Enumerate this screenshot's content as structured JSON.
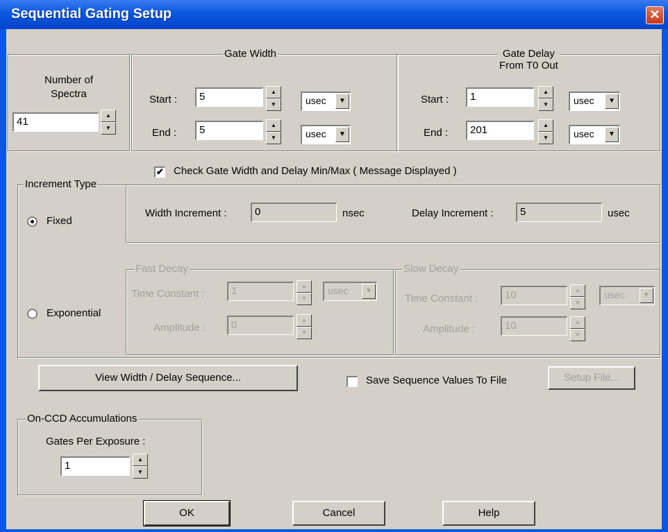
{
  "window": {
    "title": "Sequential Gating Setup",
    "close_glyph": "✕"
  },
  "spectra": {
    "label": "Number of\nSpectra",
    "value": "41"
  },
  "gate_width": {
    "title": "Gate Width",
    "start_label": "Start :",
    "start_value": "5",
    "start_unit": "usec",
    "end_label": "End :",
    "end_value": "5",
    "end_unit": "usec"
  },
  "gate_delay": {
    "title": "Gate Delay\nFrom T0 Out",
    "start_label": "Start :",
    "start_value": "1",
    "start_unit": "usec",
    "end_label": "End :",
    "end_value": "201",
    "end_unit": "usec"
  },
  "check_minmax": {
    "label": "Check Gate  Width and Delay Min/Max ( Message Displayed )",
    "checked": true
  },
  "increment": {
    "title": "Increment Type",
    "fixed_label": "Fixed",
    "exponential_label": "Exponential",
    "selected": "fixed",
    "width_label": "Width Increment :",
    "width_value": "0",
    "width_unit": "nsec",
    "delay_label": "Delay Increment :",
    "delay_value": "5",
    "delay_unit": "usec"
  },
  "fast_decay": {
    "title": "Fast Decay",
    "time_label": "Time Constant :",
    "time_value": "1",
    "time_unit": "usec",
    "amp_label": "Amplitude :",
    "amp_value": "0"
  },
  "slow_decay": {
    "title": "Slow Decay",
    "time_label": "Time Constant :",
    "time_value": "10",
    "time_unit": "usec",
    "amp_label": "Amplitude :",
    "amp_value": "10"
  },
  "sequence": {
    "view_button": "View Width / Delay Sequence...",
    "save_label": "Save Sequence Values To File",
    "save_checked": false,
    "setup_button": "Setup File..."
  },
  "accumulations": {
    "title": "On-CCD Accumulations",
    "gates_label": "Gates Per Exposure :",
    "gates_value": "1"
  },
  "buttons": {
    "ok": "OK",
    "cancel": "Cancel",
    "help": "Help"
  },
  "icons": {
    "spin_up": "▲",
    "spin_down": "▼",
    "dropdown": "▼",
    "check": "✔"
  }
}
